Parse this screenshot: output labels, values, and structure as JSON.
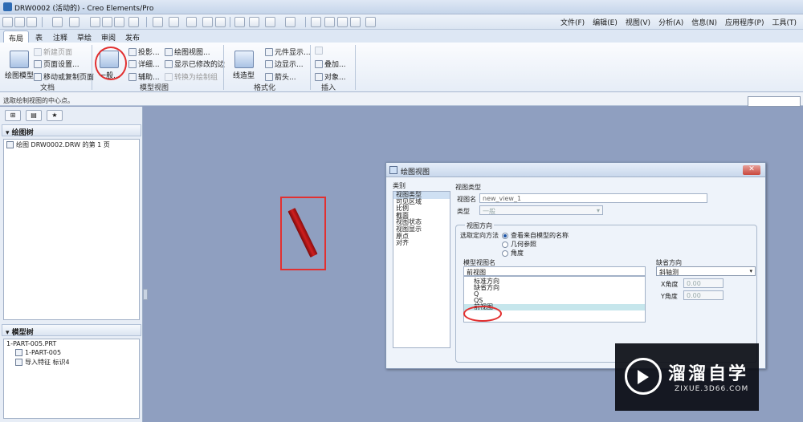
{
  "window": {
    "title": "DRW0002 (活动的) - Creo Elements/Pro"
  },
  "menubar": [
    "文件(F)",
    "编辑(E)",
    "视图(V)",
    "分析(A)",
    "信息(N)",
    "应用程序(P)",
    "工具(T)"
  ],
  "tabs": [
    "布局",
    "表",
    "注释",
    "草绘",
    "审阅",
    "发布"
  ],
  "ribbon": {
    "drawing_model": "绘图模型",
    "new_page": "新建页面",
    "page_setup": "页面设置...",
    "move_copy_page": "移动或复制页面",
    "general": "一般...",
    "projection": "投影...",
    "detail": "详细...",
    "auxiliary": "辅助...",
    "drawing_view": "绘图视图...",
    "show_modified_edges": "显示已修改的边",
    "convert_to_draft": "转换为绘制组",
    "line_style": "线造型",
    "element_display": "元件显示...",
    "edge_display": "边显示...",
    "arrow": "箭头...",
    "overlay": "叠加...",
    "object": "对象...",
    "group_document": "文档",
    "group_model_views": "模型视图",
    "group_format": "格式化",
    "group_insert": "插入"
  },
  "status": {
    "message": "选取绘制视图的中心点。"
  },
  "left_panel": {
    "drawing_tree_title": "绘图树",
    "drawing_tree_items": [
      "绘图 DRW0002.DRW 的第 1 页"
    ],
    "model_tree_title": "模型树",
    "model_tree_items": [
      "1-PART-005.PRT",
      "1-PART-005",
      "导入特征 标识4"
    ]
  },
  "dialog": {
    "title": "绘图视图",
    "category_label": "类别",
    "categories": [
      "视图类型",
      "可见区域",
      "比例",
      "截面",
      "视图状态",
      "视图显示",
      "原点",
      "对齐"
    ],
    "section_title": "视图类型",
    "view_name_label": "视图名",
    "view_name_value": "new_view_1",
    "type_label": "类型",
    "type_value": "一般",
    "orientation_title": "视图方向",
    "orientation_method_label": "选取定向方法",
    "orientation_options": [
      "查看来自模型的名称",
      "几何参照",
      "角度"
    ],
    "model_view_names_label": "模型视图名",
    "model_view_name_value": "前视图",
    "model_view_list": [
      "标准方向",
      "缺省方向",
      "Q",
      "QS",
      "前视图"
    ],
    "default_orientation_label": "缺省方向",
    "default_orientation_value": "斜轴测",
    "x_angle_label": "X角度",
    "x_angle_value": "0.00",
    "y_angle_label": "Y角度",
    "y_angle_value": "0.00"
  },
  "watermark": {
    "name": "溜溜自学",
    "url": "ZIXUE.3D66.COM"
  }
}
